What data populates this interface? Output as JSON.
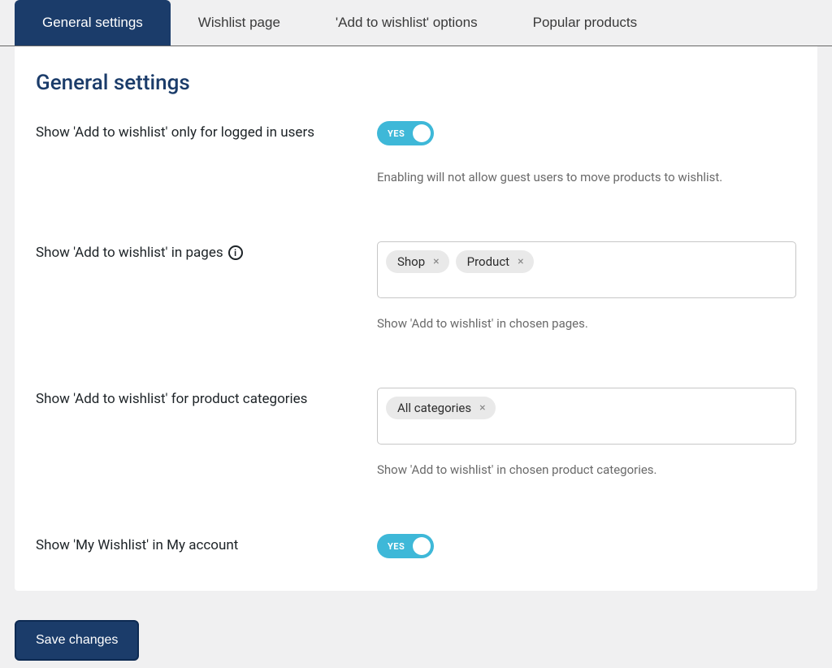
{
  "tabs": [
    {
      "label": "General settings",
      "active": true
    },
    {
      "label": "Wishlist page",
      "active": false
    },
    {
      "label": "'Add to wishlist' options",
      "active": false
    },
    {
      "label": "Popular products",
      "active": false
    }
  ],
  "panel_title": "General settings",
  "settings": {
    "logged_only": {
      "label": "Show 'Add to wishlist' only for logged in users",
      "toggle": "YES",
      "description": "Enabling will not allow guest users to move products to wishlist."
    },
    "pages": {
      "label": "Show 'Add to wishlist' in pages",
      "tags": [
        "Shop",
        "Product"
      ],
      "description": "Show 'Add to wishlist' in chosen pages."
    },
    "categories": {
      "label": "Show 'Add to wishlist' for product categories",
      "tags": [
        "All categories"
      ],
      "description": "Show 'Add to wishlist' in chosen product categories."
    },
    "my_account": {
      "label": "Show 'My Wishlist' in My account",
      "toggle": "YES"
    }
  },
  "save_button": "Save changes"
}
